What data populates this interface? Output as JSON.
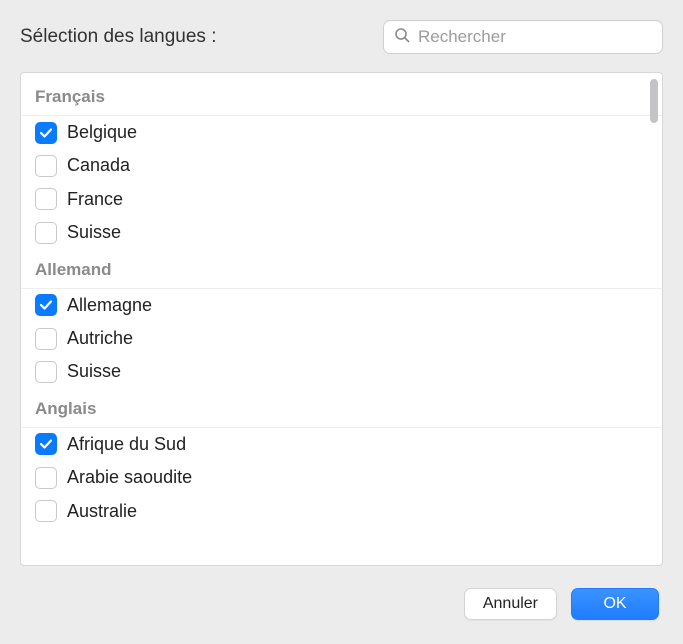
{
  "title": "Sélection des langues :",
  "search": {
    "placeholder": "Rechercher",
    "value": ""
  },
  "groups": [
    {
      "header": "Français",
      "items": [
        {
          "label": "Belgique",
          "checked": true
        },
        {
          "label": "Canada",
          "checked": false
        },
        {
          "label": "France",
          "checked": false
        },
        {
          "label": "Suisse",
          "checked": false
        }
      ]
    },
    {
      "header": "Allemand",
      "items": [
        {
          "label": "Allemagne",
          "checked": true
        },
        {
          "label": "Autriche",
          "checked": false
        },
        {
          "label": "Suisse",
          "checked": false
        }
      ]
    },
    {
      "header": "Anglais",
      "items": [
        {
          "label": "Afrique du Sud",
          "checked": true
        },
        {
          "label": "Arabie saoudite",
          "checked": false
        },
        {
          "label": "Australie",
          "checked": false
        }
      ]
    }
  ],
  "buttons": {
    "cancel": "Annuler",
    "ok": "OK"
  },
  "colors": {
    "accent": "#0a7bff"
  }
}
